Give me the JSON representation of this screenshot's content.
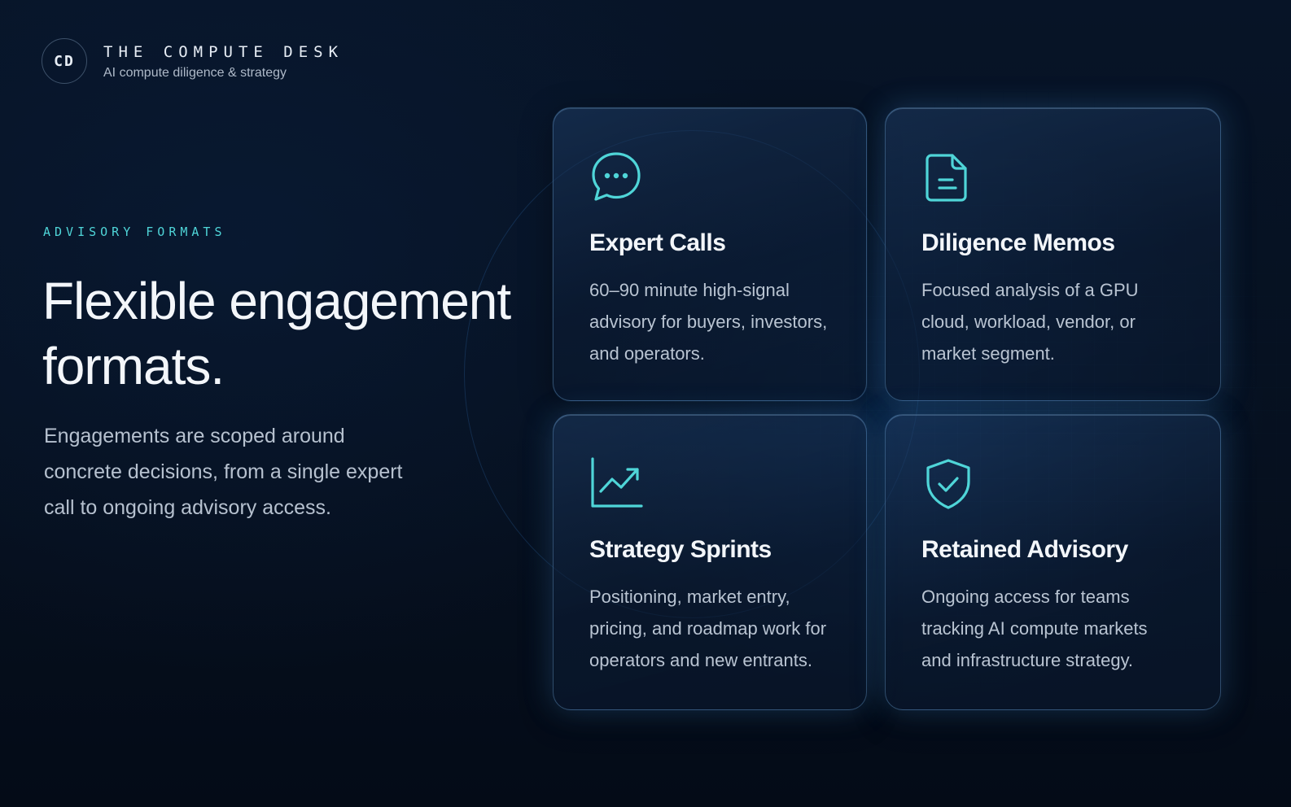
{
  "brand": {
    "mark": "CD",
    "name": "THE COMPUTE DESK",
    "tagline": "AI compute diligence & strategy"
  },
  "hero": {
    "eyebrow": "ADVISORY FORMATS",
    "headline": "Flexible engagement formats.",
    "lede": "Engagements are scoped around concrete decisions, from a single expert call to ongoing advisory access."
  },
  "colors": {
    "accent": "#4fd5d8",
    "background": "#06101f",
    "card_border": "#78b4eb"
  },
  "cards": [
    {
      "icon": "chat-bubble-icon",
      "title": "Expert Calls",
      "body": "60–90 minute high-signal advisory for buyers, investors, and operators."
    },
    {
      "icon": "document-icon",
      "title": "Diligence Memos",
      "body": "Focused analysis of a GPU cloud, workload, vendor, or market segment."
    },
    {
      "icon": "trend-chart-icon",
      "title": "Strategy Sprints",
      "body": "Positioning, market entry, pricing, and roadmap work for operators and new entrants."
    },
    {
      "icon": "shield-check-icon",
      "title": "Retained Advisory",
      "body": "Ongoing access for teams tracking AI compute markets and infrastructure strategy."
    }
  ]
}
